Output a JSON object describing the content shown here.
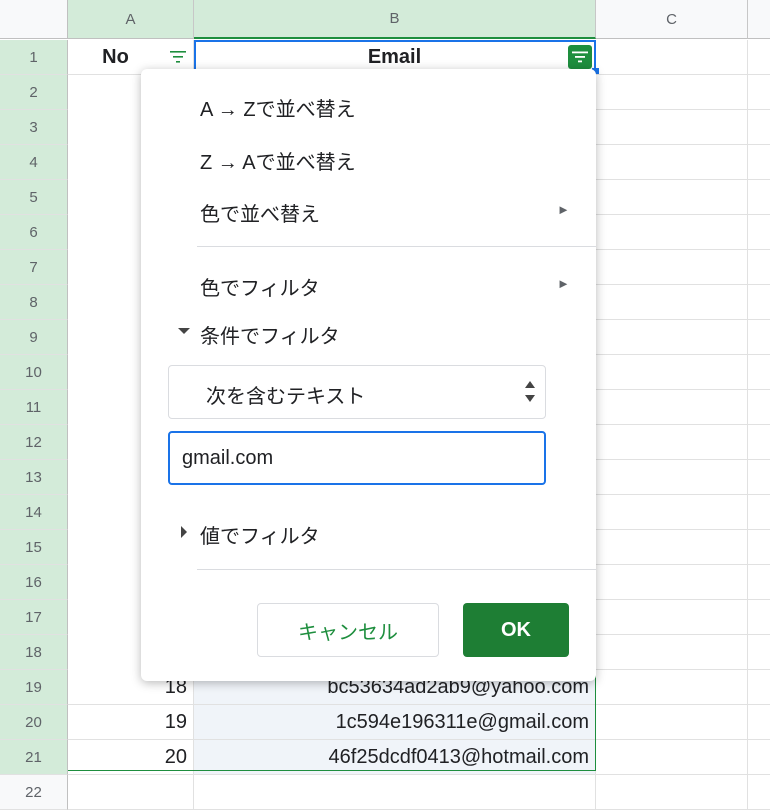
{
  "columns": [
    "A",
    "B",
    "C"
  ],
  "row_numbers": [
    "1",
    "2",
    "3",
    "4",
    "5",
    "6",
    "7",
    "8",
    "9",
    "10",
    "11",
    "12",
    "13",
    "14",
    "15",
    "16",
    "17",
    "18",
    "19",
    "20",
    "21",
    "22"
  ],
  "header_row": {
    "no": "No",
    "email": "Email"
  },
  "visible_rows": [
    {
      "no": "18",
      "email": "bc53634ad2ab9@yahoo.com"
    },
    {
      "no": "19",
      "email": "1c594e196311e@gmail.com"
    },
    {
      "no": "20",
      "email": "46f25dcdf0413@hotmail.com"
    }
  ],
  "filter_menu": {
    "sort_az": "A → Zで並べ替え",
    "sort_za": "Z → Aで並べ替え",
    "sort_by_color": "色で並べ替え",
    "filter_by_color": "色でフィルタ",
    "filter_by_condition": "条件でフィルタ",
    "condition_selected": "次を含むテキスト",
    "condition_value": "gmail.com",
    "filter_by_values": "値でフィルタ",
    "cancel_label": "キャンセル",
    "ok_label": "OK",
    "submenu_arrow": "►"
  },
  "colors": {
    "accent_green": "#1e8e3e",
    "focus_blue": "#1a73e8"
  }
}
